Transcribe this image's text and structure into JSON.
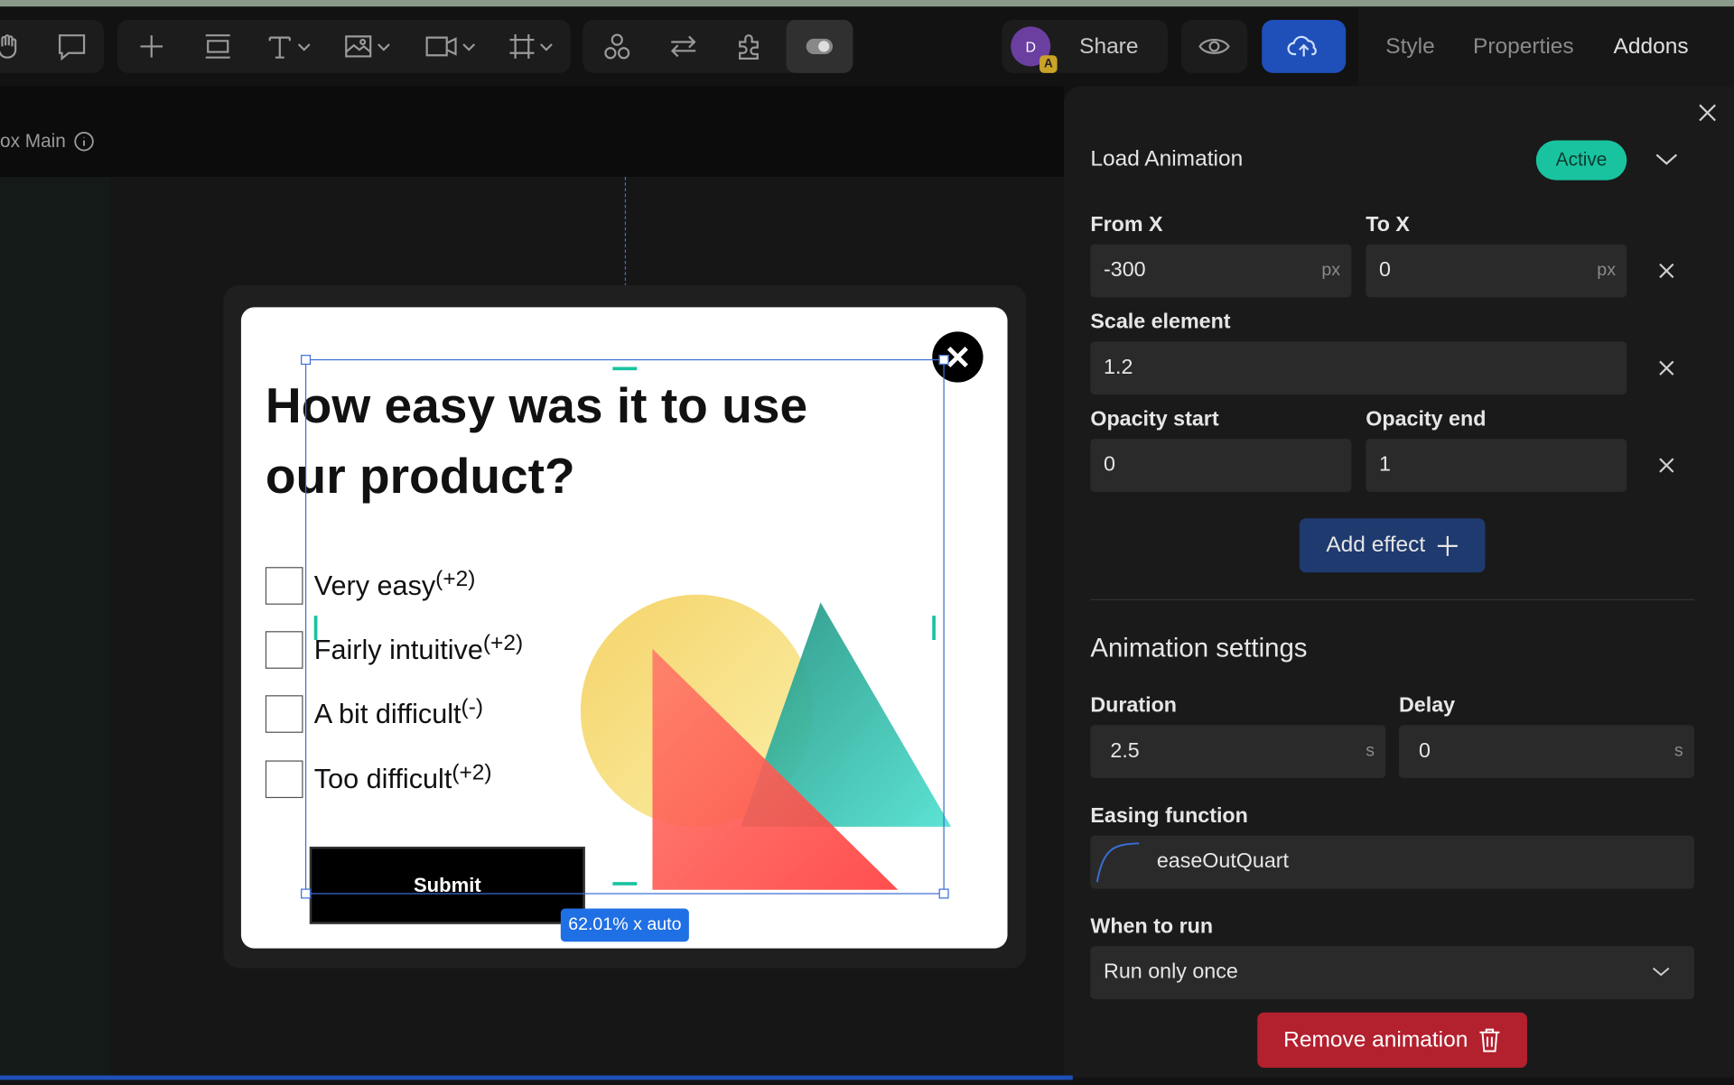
{
  "toolbar": {
    "share_label": "Share",
    "avatar_initial": "D",
    "avatar_badge": "A",
    "tools": [
      "hand-icon",
      "comment-icon",
      "plus-icon",
      "section-icon",
      "text-icon",
      "image-icon",
      "video-icon",
      "frame-icon",
      "components-icon",
      "interactions-icon",
      "plugins-icon",
      "toggle-icon"
    ]
  },
  "panel_tabs": [
    {
      "label": "Style"
    },
    {
      "label": "Properties"
    },
    {
      "label": "Addons"
    }
  ],
  "breadcrumb": {
    "label": "ox Main"
  },
  "popup": {
    "question": "How easy was it to use our product?",
    "options": [
      {
        "label": "Very easy",
        "score": "(+2)"
      },
      {
        "label": "Fairly intuitive",
        "score": "(+2)"
      },
      {
        "label": "A bit difficult",
        "score": "(-)"
      },
      {
        "label": "Too difficult",
        "score": "(+2)"
      }
    ],
    "submit_label": "Submit"
  },
  "selection": {
    "size_label": "62.01% x auto"
  },
  "load_animation": {
    "title": "Load Animation",
    "status": "Active",
    "from_x": {
      "label": "From X",
      "value": "-300",
      "unit": "px"
    },
    "to_x": {
      "label": "To X",
      "value": "0",
      "unit": "px"
    },
    "scale": {
      "label": "Scale element",
      "value": "1.2"
    },
    "opacity_start": {
      "label": "Opacity start",
      "value": "0"
    },
    "opacity_end": {
      "label": "Opacity end",
      "value": "1"
    },
    "add_effect_label": "Add effect"
  },
  "animation_settings": {
    "title": "Animation settings",
    "duration": {
      "label": "Duration",
      "value": "2.5",
      "unit": "s"
    },
    "delay": {
      "label": "Delay",
      "value": "0",
      "unit": "s"
    },
    "easing": {
      "label": "Easing function",
      "value": "easeOutQuart"
    },
    "when_to_run": {
      "label": "When to run",
      "value": "Run only once"
    },
    "remove_label": "Remove animation"
  },
  "colors": {
    "accent_blue": "#1f4fb8",
    "active_green": "#19c3a0",
    "danger_red": "#b3202e"
  }
}
